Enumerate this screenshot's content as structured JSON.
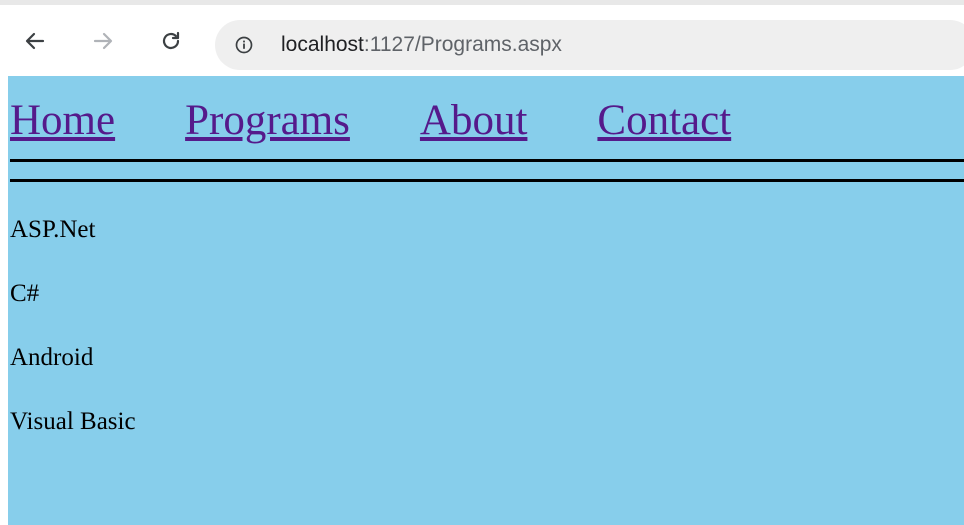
{
  "browser": {
    "url_host": "localhost",
    "url_rest": ":1127/Programs.aspx",
    "icons": {
      "back": "arrow-left-icon",
      "forward": "arrow-right-icon",
      "reload": "reload-icon",
      "site_info": "info-icon"
    }
  },
  "page": {
    "background_color": "#87ceeb",
    "link_color": "#551a8b",
    "nav_links": [
      {
        "label": "Home"
      },
      {
        "label": "Programs"
      },
      {
        "label": "About"
      },
      {
        "label": "Contact"
      }
    ],
    "programs": [
      {
        "label": "ASP.Net"
      },
      {
        "label": "C#"
      },
      {
        "label": "Android"
      },
      {
        "label": "Visual Basic"
      }
    ]
  }
}
